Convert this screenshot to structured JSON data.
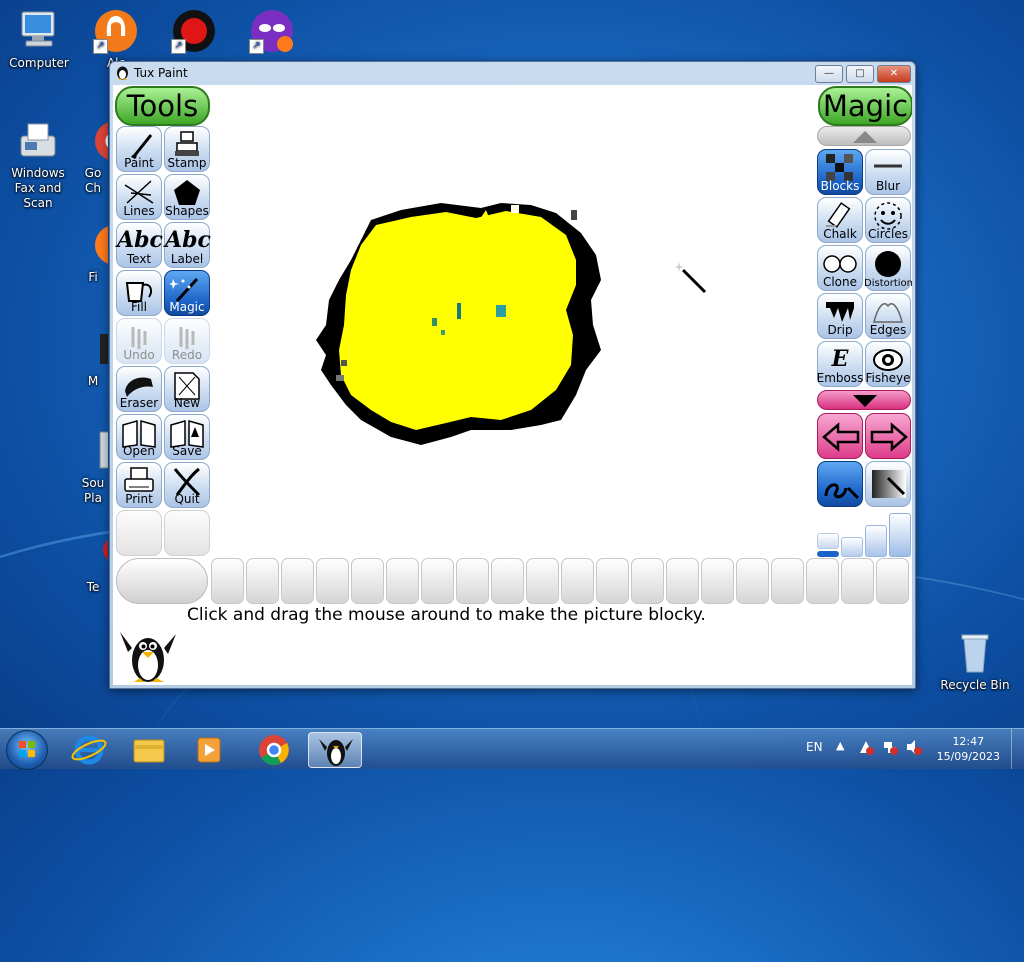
{
  "desktop": {
    "icons": [
      {
        "label": "Computer"
      },
      {
        "label": "Alc"
      },
      {
        "label": "Windows Fax and Scan"
      },
      {
        "label": "Go Ch"
      },
      {
        "label": "Fi"
      },
      {
        "label": "M"
      },
      {
        "label": "Sou Pla"
      },
      {
        "label": "Te"
      },
      {
        "label": "Recycle Bin"
      }
    ]
  },
  "window": {
    "title": "Tux Paint",
    "controls": {
      "minimize": "—",
      "maximize": "□",
      "close": "✕"
    }
  },
  "tuxpaint": {
    "tools_header": "Tools",
    "magic_header": "Magic",
    "tools": [
      {
        "label": "Paint",
        "icon": "paintbrush-icon"
      },
      {
        "label": "Stamp",
        "icon": "stamp-icon"
      },
      {
        "label": "Lines",
        "icon": "lines-icon"
      },
      {
        "label": "Shapes",
        "icon": "pentagon-icon"
      },
      {
        "label": "Text",
        "icon": "abc-icon",
        "glyph": "Abc"
      },
      {
        "label": "Label",
        "icon": "abc-label-icon",
        "glyph": "Abc"
      },
      {
        "label": "Fill",
        "icon": "bucket-icon"
      },
      {
        "label": "Magic",
        "icon": "magic-wand-icon",
        "selected": true
      },
      {
        "label": "Undo",
        "icon": "undo-icon"
      },
      {
        "label": "Redo",
        "icon": "redo-icon"
      },
      {
        "label": "Eraser",
        "icon": "eraser-icon"
      },
      {
        "label": "New",
        "icon": "new-page-icon"
      },
      {
        "label": "Open",
        "icon": "open-book-icon"
      },
      {
        "label": "Save",
        "icon": "save-book-icon"
      },
      {
        "label": "Print",
        "icon": "printer-icon"
      },
      {
        "label": "Quit",
        "icon": "quit-icon"
      }
    ],
    "magic_tools": [
      {
        "label": "Blocks",
        "icon": "blocks-icon",
        "selected": true
      },
      {
        "label": "Blur",
        "icon": "blur-icon"
      },
      {
        "label": "Chalk",
        "icon": "chalk-icon"
      },
      {
        "label": "Circles",
        "icon": "circles-icon"
      },
      {
        "label": "Clone",
        "icon": "clone-icon"
      },
      {
        "label": "Distortion",
        "icon": "distortion-icon"
      },
      {
        "label": "Drip",
        "icon": "drip-icon"
      },
      {
        "label": "Edges",
        "icon": "edges-icon"
      },
      {
        "label": "Emboss",
        "icon": "emboss-icon",
        "glyph": "E"
      },
      {
        "label": "Fisheye",
        "icon": "fisheye-icon"
      }
    ],
    "instruction": "Click and drag the mouse around to make the picture blocky.",
    "colors": {
      "accent": "#1b63c8",
      "header": "#3ea626",
      "scroll_up": "#c8c8c8",
      "scroll_down": "#e0479a"
    }
  },
  "taskbar": {
    "apps": [
      {
        "name": "internet-explorer-icon"
      },
      {
        "name": "file-explorer-icon"
      },
      {
        "name": "media-player-icon"
      },
      {
        "name": "chrome-icon"
      },
      {
        "name": "tux-paint-icon",
        "active": true
      }
    ],
    "language": "EN",
    "time": "12:47",
    "date": "15/09/2023"
  }
}
